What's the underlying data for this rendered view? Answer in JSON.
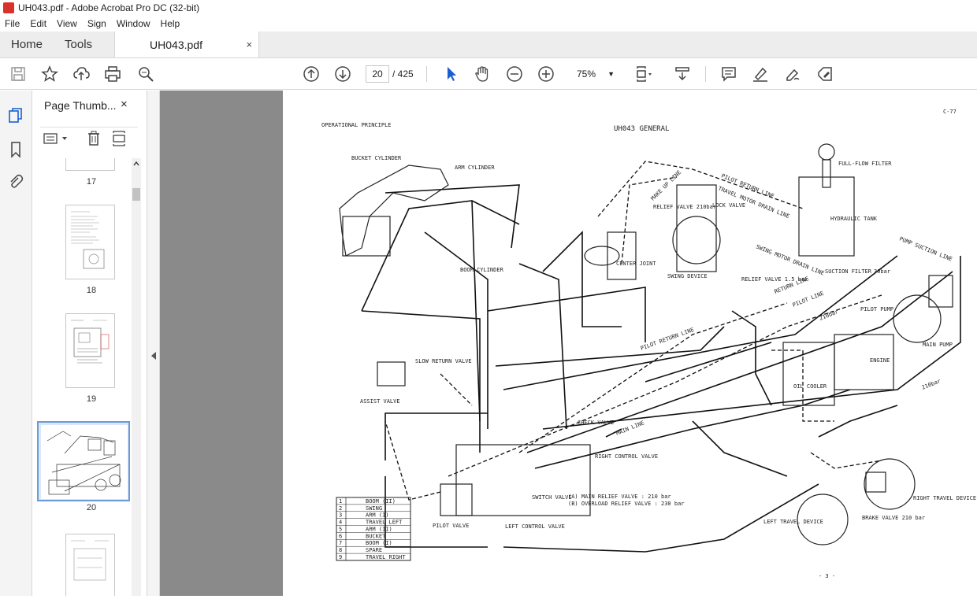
{
  "window": {
    "title": "UH043.pdf - Adobe Acrobat Pro DC (32-bit)"
  },
  "menu": [
    "File",
    "Edit",
    "View",
    "Sign",
    "Window",
    "Help"
  ],
  "tabs": {
    "home": "Home",
    "tools": "Tools",
    "document": "UH043.pdf",
    "close": "×"
  },
  "toolbar": {
    "current_page": "20",
    "total_pages": "/ 425",
    "zoom": "75%"
  },
  "thumbnails": {
    "title": "Page Thumb...",
    "close": "×",
    "pages": [
      "17",
      "18",
      "19",
      "20"
    ],
    "selected": "20"
  },
  "page": {
    "corner_id": "C-77",
    "heading_left": "OPERATIONAL PRINCIPLE",
    "heading_center": "UH043 GENERAL",
    "page_number": "- 3 -",
    "labels": {
      "bucket_cylinder": "BUCKET CYLINDER",
      "arm_cylinder": "ARM CYLINDER",
      "boom_cylinder": "BOOM CYLINDER",
      "center_joint": "CENTER JOINT",
      "swing_device": "SWING DEVICE",
      "relief_valve_210": "RELIEF VALVE 210bar",
      "lock_valve": "LOCK VALVE",
      "full_flow_filter": "FULL-FLOW FILTER",
      "hydraulic_tank": "HYDRAULIC TANK",
      "suction_filter": "SUCTION FILTER",
      "pilot_return_line": "PILOT RETURN LINE",
      "travel_motor_drain_line": "TRAVEL MOTOR DRAIN LINE",
      "swing_motor_drain_line": "SWING MOTOR DRAIN LINE",
      "make_up_line": "MAKE UP LINE",
      "return_line": "RETURN LINE",
      "pilot_line": "PILOT LINE",
      "pump_suction_line": "PUMP SUCTION LINE",
      "relief_valve_15": "RELIEF VALVE 1.5 bar",
      "pilot_pump": "PILOT PUMP",
      "main_pump": "MAIN PUMP",
      "engine": "ENGINE",
      "oil_cooler": "OIL COOLER",
      "slow_return_valve": "SLOW RETURN VALVE",
      "assist_valve": "ASSIST VALVE",
      "check_valve": "CHECK VALVE",
      "main_line": "MAIN LINE",
      "right_control_valve": "RIGHT CONTROL VALVE",
      "switch_valve": "SWITCH VALVE",
      "left_control_valve": "LEFT CONTROL VALVE",
      "pilot_valve": "PILOT VALVE",
      "main_relief": "(A) MAIN RELIEF VALVE   : 210 bar",
      "overload_relief": "(B) OVERLOAD RELIEF VALVE : 230 bar",
      "left_travel_device": "LEFT TRAVEL DEVICE",
      "right_travel_device": "RIGHT TRAVEL DEVICE",
      "brake_valve": "BRAKE VALVE 210 bar",
      "pilot_return_line_2": "PILOT RETURN LINE",
      "pressure_30": "30bar",
      "pressure_210": "210bar",
      "pressure_210b": "210bar"
    },
    "legend": [
      {
        "n": "1",
        "name": "BOOM (II)"
      },
      {
        "n": "2",
        "name": "SWING"
      },
      {
        "n": "3",
        "name": "ARM (I)"
      },
      {
        "n": "4",
        "name": "TRAVEL LEFT"
      },
      {
        "n": "5",
        "name": "ARM (II)"
      },
      {
        "n": "6",
        "name": "BUCKET"
      },
      {
        "n": "7",
        "name": "BOOM (I)"
      },
      {
        "n": "8",
        "name": "SPARE"
      },
      {
        "n": "9",
        "name": "TRAVEL RIGHT"
      }
    ]
  }
}
